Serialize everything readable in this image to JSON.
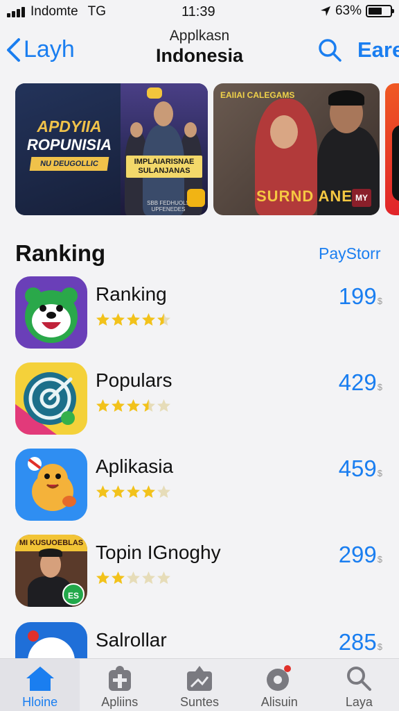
{
  "status_bar": {
    "carrier": "Indomte",
    "network": "TG",
    "time": "11:39",
    "battery": "63%",
    "battery_level": 0.63
  },
  "nav": {
    "back_label": "Layh",
    "title_top": "Applkasn",
    "title_main": "Indonesia",
    "right_label": "Eare"
  },
  "banners": [
    {
      "line1": "APDYIIA",
      "line2": "ROPUNISIA",
      "tag": "NU DEUGOLLIC",
      "sign": "IMPLAIARISNAE SULANJANAS",
      "sub": "SBB FEDHUOLS UPFENEDES"
    },
    {
      "header": "EAIIAI CALEGAMS",
      "title": "SURND ANEN",
      "logo": "MY"
    }
  ],
  "ranking": {
    "title": "Ranking",
    "see_all": "PayStorr",
    "items": [
      {
        "name": "Ranking",
        "price": "199",
        "currency": "$",
        "rating": 4.5,
        "icon": "bear-mascot-icon",
        "icon_bg": "#6a3fb8"
      },
      {
        "name": "Populars",
        "price": "429",
        "currency": "$",
        "rating": 3.5,
        "icon": "target-app-icon",
        "icon_bg": "#f4d13a"
      },
      {
        "name": "Aplikasia",
        "price": "459",
        "currency": "$",
        "rating": 4,
        "icon": "hamster-mascot-icon",
        "icon_bg": "#2f8ef2"
      },
      {
        "name": "Topin IGnoghy",
        "price": "299",
        "currency": "$",
        "rating": 2,
        "icon": "presenter-photo-icon",
        "icon_bg": "#5a3a2a"
      },
      {
        "name": "Salrollar",
        "price": "285",
        "currency": "$",
        "rating": 0,
        "icon": "ball-app-icon",
        "icon_bg": "#1f6fd8"
      }
    ],
    "icon1_text": "MI KUSUOEBLAS",
    "icon4_badge": "ES"
  },
  "tabs": [
    {
      "label": "Hloine",
      "icon": "home-icon",
      "active": true
    },
    {
      "label": "Apliins",
      "icon": "apps-icon",
      "active": false
    },
    {
      "label": "Suntes",
      "icon": "games-icon",
      "active": false
    },
    {
      "label": "Alisuin",
      "icon": "arcade-icon",
      "active": false
    },
    {
      "label": "Laya",
      "icon": "search-icon",
      "active": false
    }
  ],
  "colors": {
    "accent": "#1a7ef0",
    "star": "#f2c21b",
    "star_empty": "#e6dcb8"
  }
}
